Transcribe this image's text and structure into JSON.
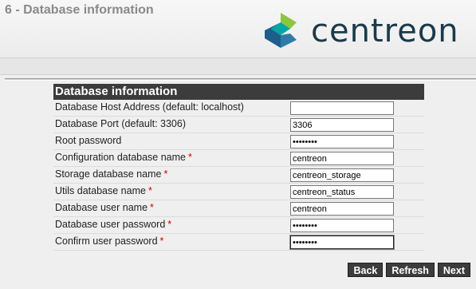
{
  "header": {
    "step_title": "6 - Database information",
    "logo_text": "centreon"
  },
  "form": {
    "title": "Database information",
    "fields": [
      {
        "label": "Database Host Address (default: localhost)",
        "required": false,
        "value": "",
        "type": "text"
      },
      {
        "label": "Database Port (default: 3306)",
        "required": false,
        "value": "3306",
        "type": "text"
      },
      {
        "label": "Root password",
        "required": false,
        "value": "••••••••",
        "type": "password"
      },
      {
        "label": "Configuration database name",
        "required": true,
        "value": "centreon",
        "type": "text"
      },
      {
        "label": "Storage database name",
        "required": true,
        "value": "centreon_storage",
        "type": "text"
      },
      {
        "label": "Utils database name",
        "required": true,
        "value": "centreon_status",
        "type": "text"
      },
      {
        "label": "Database user name",
        "required": true,
        "value": "centreon",
        "type": "text"
      },
      {
        "label": "Database user password",
        "required": true,
        "value": "••••••••",
        "type": "password"
      },
      {
        "label": "Confirm user password",
        "required": true,
        "value": "••••••••",
        "type": "password",
        "focused": true
      }
    ],
    "required_marker": "*"
  },
  "buttons": {
    "back": "Back",
    "refresh": "Refresh",
    "next": "Next"
  },
  "colors": {
    "accent_dark": "#3c3c3c",
    "required": "#cc0000",
    "logo_green": "#8cc63f",
    "logo_teal": "#00a6a6",
    "logo_blue": "#1d5f8a"
  }
}
